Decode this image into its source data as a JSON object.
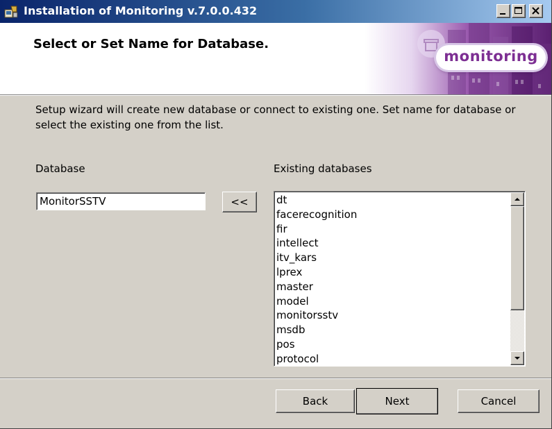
{
  "window": {
    "title": "Installation of Monitoring v.7.0.0.432",
    "controls": [
      "minimize",
      "maximize",
      "close"
    ],
    "icon": "installer-icon"
  },
  "header": {
    "title": "Select or Set Name for Database.",
    "logo_text": "monitoring",
    "accent_color": "#7d2f93"
  },
  "main": {
    "description": "Setup wizard will create new database or connect to existing one. Set name for database or select the existing one from the list.",
    "database_label": "Database",
    "database_value": "MonitorSSTV",
    "copy_button_label": "<<",
    "existing_label": "Existing databases",
    "existing_databases": [
      "dt",
      "facerecognition",
      "fir",
      "intellect",
      "itv_kars",
      "lprex",
      "master",
      "model",
      "monitorsstv",
      "msdb",
      "pos",
      "protocol"
    ]
  },
  "footer": {
    "back_label": "Back",
    "next_label": "Next",
    "cancel_label": "Cancel"
  }
}
